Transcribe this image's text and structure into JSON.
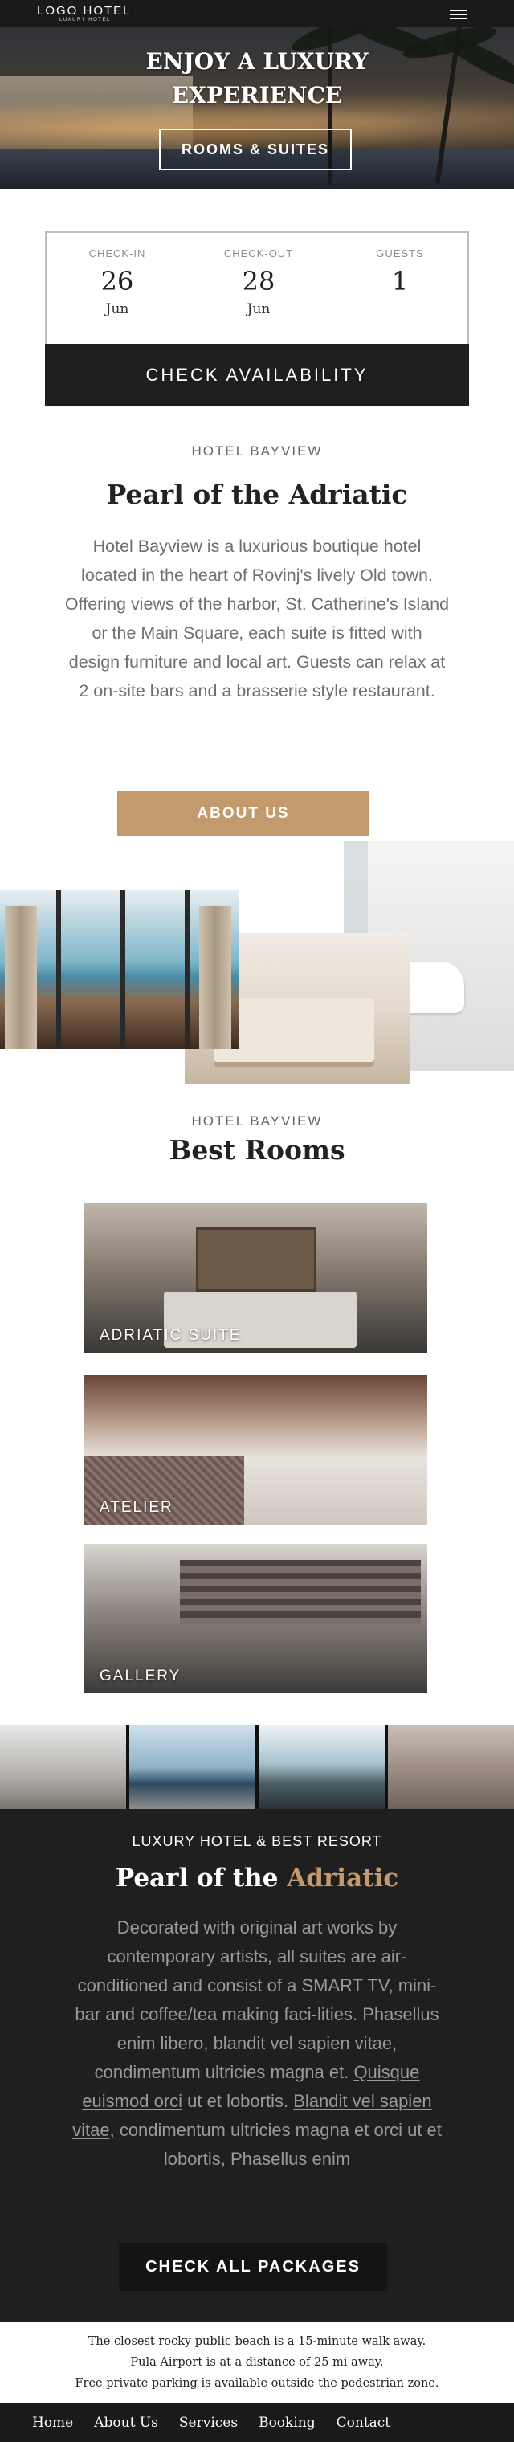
{
  "header": {
    "logo": "LOGO HOTEL",
    "logo_sub": "LUXURY HOTEL",
    "hero_title_line1": "ENJOY A LUXURY",
    "hero_title_line2": "EXPERIENCE",
    "hero_button": "ROOMS & SUITES"
  },
  "booking": {
    "checkin_label": "CHECK-IN",
    "checkin_day": "26",
    "checkin_month": "Jun",
    "checkout_label": "CHECK-OUT",
    "checkout_day": "28",
    "checkout_month": "Jun",
    "guests_label": "GUESTS",
    "guests_value": "1",
    "button": "CHECK AVAILABILITY"
  },
  "about": {
    "kicker": "HOTEL BAYVIEW",
    "title": "Pearl of the Adriatic",
    "text": "Hotel Bayview is a luxurious boutique hotel located in the heart of Rovinj's lively Old town. Offering views of the harbor, St. Catherine's Island or the Main Square, each suite is fitted with design furniture and local art. Guests can relax at 2 on-site bars and a brasserie style restaurant.",
    "button": "ABOUT US"
  },
  "rooms": {
    "kicker": "HOTEL BAYVIEW",
    "title": "Best Rooms",
    "items": [
      "ADRIATIC SUITE",
      "ATELIER",
      "GALLERY"
    ]
  },
  "resort": {
    "kicker": "LUXURY HOTEL & BEST RESORT",
    "title_main": "Pearl of the ",
    "title_accent": "Adriatic",
    "text_part1": "Decorated with original art works by contemporary artists, all suites are air-conditioned and consist of a SMART TV, mini-bar and coffee/tea making faci-lities. Phasellus enim libero, blandit vel sapien vitae, condimentum ultricies magna et. ",
    "link1": "Quisque euismod orci",
    "text_part2": " ut et lobortis. ",
    "link2": "Blandit vel sapien vitae,",
    "text_part3": " condimentum ultricies magna et orci ut et lobortis, Phasellus enim",
    "button": "CHECK ALL PACKAGES"
  },
  "footer": {
    "line1": "The closest rocky public beach is a 15-minute walk away.",
    "line2": "Pula Airport is at a distance of 25 mi away.",
    "line3": "Free private parking is available outside the pedestrian zone.",
    "nav": [
      "Home",
      "About Us",
      "Services",
      "Booking",
      "Contact"
    ]
  },
  "colors": {
    "accent": "#c29a6b",
    "dark": "#1f1f1f"
  },
  "icons": {
    "menu": "hamburger-menu-icon"
  }
}
